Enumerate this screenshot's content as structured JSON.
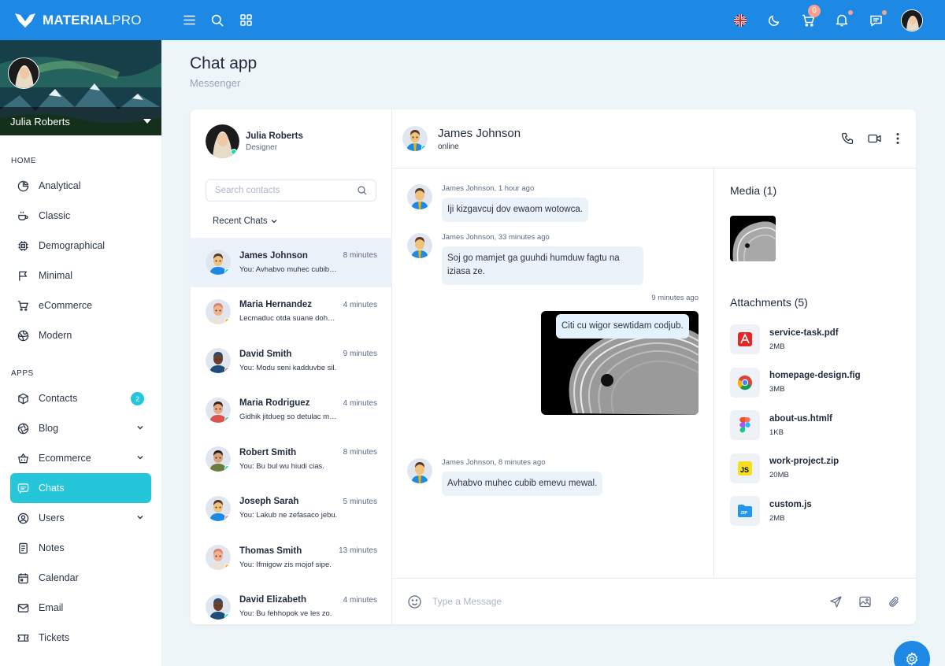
{
  "brand": {
    "name_bold": "MATERIAL",
    "name_light": "PRO"
  },
  "topbar": {
    "cart_count": "0"
  },
  "sidebar": {
    "user_name": "Julia Roberts",
    "home_caption": "HOME",
    "home_items": [
      {
        "label": "Analytical",
        "icon": "pie-chart-icon"
      },
      {
        "label": "Classic",
        "icon": "coffee-icon"
      },
      {
        "label": "Demographical",
        "icon": "cpu-icon"
      },
      {
        "label": "Minimal",
        "icon": "flag-icon"
      },
      {
        "label": "eCommerce",
        "icon": "cart-icon"
      },
      {
        "label": "Modern",
        "icon": "globe-icon"
      }
    ],
    "apps_caption": "APPS",
    "app_items": [
      {
        "label": "Contacts",
        "icon": "box-icon",
        "badge": "2"
      },
      {
        "label": "Blog",
        "icon": "aperture-icon"
      },
      {
        "label": "Ecommerce",
        "icon": "basket-icon"
      },
      {
        "label": "Chats",
        "icon": "message-icon"
      },
      {
        "label": "Users",
        "icon": "user-circle-icon"
      },
      {
        "label": "Notes",
        "icon": "notes-icon"
      },
      {
        "label": "Calendar",
        "icon": "calendar-icon"
      },
      {
        "label": "Email",
        "icon": "mail-icon"
      },
      {
        "label": "Tickets",
        "icon": "ticket-icon"
      }
    ]
  },
  "page": {
    "title": "Chat app",
    "subtitle": "Messenger"
  },
  "me": {
    "name": "Julia Roberts",
    "role": "Designer"
  },
  "search": {
    "placeholder": "Search contacts"
  },
  "recent_label": "Recent Chats",
  "contacts": [
    {
      "name": "James Johnson",
      "time": "8 minutes",
      "msg": "You: Avhabvo muhec cubib emevu mewal.",
      "status": "#13deb9",
      "skin": "#f1c27d",
      "hair": "#5a3825",
      "shirt": "#1e88e5"
    },
    {
      "name": "Maria Hernandez",
      "time": "4 minutes",
      "msg": "Lecmaduc otda suane dohu nat.",
      "status": "#ffae1f",
      "skin": "#f3b28f",
      "hair": "#d9826a",
      "shirt": "#e9e3dc"
    },
    {
      "name": "David Smith",
      "time": "9 minutes",
      "msg": "You: Modu seni kadduvbe sil.",
      "status": "#fa896b",
      "skin": "#6b3f2a",
      "hair": "#1f4d7a",
      "shirt": "#1f4d7a"
    },
    {
      "name": "Maria Rodriguez",
      "time": "4 minutes",
      "msg": "Gidhik jitdueg so detulac meb.",
      "status": "#13deb9",
      "skin": "#e8a580",
      "hair": "#3b2416",
      "shirt": "#d9534f"
    },
    {
      "name": "Robert Smith",
      "time": "8 minutes",
      "msg": "You: Bu bul wu hiudi cias.",
      "status": "#13deb9",
      "skin": "#d9a27c",
      "hair": "#2a1d14",
      "shirt": "#6b7d3a"
    },
    {
      "name": "Joseph Sarah",
      "time": "5 minutes",
      "msg": "You: Lakub ne zefasaco jebu.",
      "status": "#fa896b",
      "skin": "#f1c27d",
      "hair": "#5a3825",
      "shirt": "#1e88e5"
    },
    {
      "name": "Thomas Smith",
      "time": "13 minutes",
      "msg": "You: Ifmigow zis mojof sipe.",
      "status": "#ffae1f",
      "skin": "#f3b28f",
      "hair": "#d9826a",
      "shirt": "#e9e3dc"
    },
    {
      "name": "David Elizabeth",
      "time": "4 minutes",
      "msg": "You: Bu fehhopok ve les zo.",
      "status": "#13deb9",
      "skin": "#6b3f2a",
      "hair": "#1f4d7a",
      "shirt": "#1f4d7a"
    }
  ],
  "chat": {
    "name": "James Johnson",
    "status": "online",
    "messages": [
      {
        "meta": "James Johnson, 1 hour ago",
        "text": "Iji kizgavcuj dov ewaom wotowca."
      },
      {
        "meta": "James Johnson, 33 minutes ago",
        "text": "Soj go mamjet ga guuhdi humduw fagtu na iziasa ze."
      },
      {
        "meta": "9 minutes ago",
        "text": "Citi cu wigor sewtidam codjub."
      },
      {
        "meta": "James Johnson, 8 minutes ago",
        "text": "Avhabvo muhec cubib emevu mewal."
      }
    ],
    "composer_placeholder": "Type a Message"
  },
  "media": {
    "title": "Media (1)",
    "attachments_title": "Attachments (5)",
    "files": [
      {
        "name": "service-task.pdf",
        "size": "2MB",
        "icon": "pdf-icon"
      },
      {
        "name": "homepage-design.fig",
        "size": "3MB",
        "icon": "chrome-icon"
      },
      {
        "name": "about-us.htmlf",
        "size": "1KB",
        "icon": "figma-icon"
      },
      {
        "name": "work-project.zip",
        "size": "20MB",
        "icon": "js-icon"
      },
      {
        "name": "custom.js",
        "size": "2MB",
        "icon": "zip-icon"
      }
    ]
  },
  "colors": {
    "primary": "#1e88e5",
    "accent": "#26c6da",
    "online": "#13deb9",
    "warning": "#ffae1f",
    "danger": "#fa896b"
  }
}
